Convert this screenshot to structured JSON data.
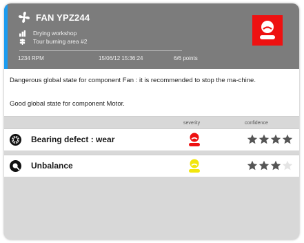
{
  "header": {
    "title": "FAN YPZ244",
    "location1": "Drying workshop",
    "location2": "Tour burning area #2",
    "rpm": "1234 RPM",
    "timestamp": "15/06/12 15:36:24",
    "points": "6/6 points",
    "accent_color": "#1b9cf0",
    "alert_color": "#ee1111"
  },
  "messages": [
    "Dangerous global state for component Fan : it is recommended to stop the ma-chine.",
    "Good global state for component Motor."
  ],
  "columns": {
    "severity": "severity",
    "confidence": "confidence"
  },
  "defects": [
    {
      "label": "Bearing defect : wear",
      "icon": "bearing-icon",
      "severity_color": "#ee1111",
      "confidence": 4,
      "confidence_max": 4
    },
    {
      "label": "Unbalance",
      "icon": "unbalance-icon",
      "severity_color": "#f2e60c",
      "confidence": 3,
      "confidence_max": 4
    }
  ]
}
